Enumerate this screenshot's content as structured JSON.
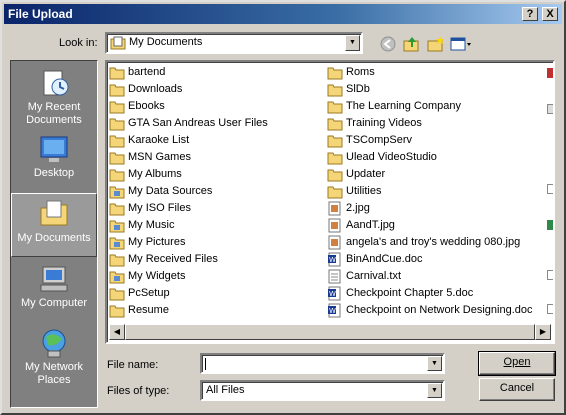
{
  "window": {
    "title": "File Upload",
    "help_button": "?",
    "close_button": "X"
  },
  "look_in": {
    "label": "Look in:",
    "value": "My Documents"
  },
  "places": [
    {
      "label": "My Recent Documents",
      "icon": "recent-documents-icon"
    },
    {
      "label": "Desktop",
      "icon": "desktop-icon"
    },
    {
      "label": "My Documents",
      "icon": "my-documents-icon",
      "selected": true
    },
    {
      "label": "My Computer",
      "icon": "my-computer-icon"
    },
    {
      "label": "My Network Places",
      "icon": "network-places-icon"
    }
  ],
  "files": {
    "column1": [
      {
        "name": "bartend",
        "type": "folder"
      },
      {
        "name": "Downloads",
        "type": "folder"
      },
      {
        "name": "Ebooks",
        "type": "folder"
      },
      {
        "name": "GTA San Andreas User Files",
        "type": "folder"
      },
      {
        "name": "Karaoke List",
        "type": "folder"
      },
      {
        "name": "MSN Games",
        "type": "folder"
      },
      {
        "name": "My Albums",
        "type": "folder"
      },
      {
        "name": "My Data Sources",
        "type": "special-folder"
      },
      {
        "name": "My ISO Files",
        "type": "folder"
      },
      {
        "name": "My Music",
        "type": "special-folder"
      },
      {
        "name": "My Pictures",
        "type": "special-folder"
      },
      {
        "name": "My Received Files",
        "type": "folder"
      },
      {
        "name": "My Widgets",
        "type": "special-folder"
      },
      {
        "name": "PcSetup",
        "type": "folder"
      },
      {
        "name": "Resume",
        "type": "folder"
      }
    ],
    "column2": [
      {
        "name": "Roms",
        "type": "folder"
      },
      {
        "name": "SlDb",
        "type": "folder"
      },
      {
        "name": "The Learning Company",
        "type": "folder"
      },
      {
        "name": "Training Videos",
        "type": "folder"
      },
      {
        "name": "TSCompServ",
        "type": "folder"
      },
      {
        "name": "Ulead VideoStudio",
        "type": "folder"
      },
      {
        "name": "Updater",
        "type": "folder"
      },
      {
        "name": "Utilities",
        "type": "folder"
      },
      {
        "name": "2.jpg",
        "type": "image"
      },
      {
        "name": "AandT.jpg",
        "type": "image"
      },
      {
        "name": "angela's and troy's wedding 080.jpg",
        "type": "image"
      },
      {
        "name": "BinAndCue.doc",
        "type": "doc"
      },
      {
        "name": "Carnival.txt",
        "type": "txt"
      },
      {
        "name": "Checkpoint Chapter 5.doc",
        "type": "doc"
      },
      {
        "name": "Checkpoint on Network Designing.doc",
        "type": "doc"
      }
    ]
  },
  "file_name": {
    "label": "File name:",
    "value": ""
  },
  "files_of_type": {
    "label": "Files of type:",
    "value": "All Files"
  },
  "buttons": {
    "open": "Open",
    "cancel": "Cancel"
  },
  "colors": {
    "title_start": "#0a246a",
    "title_end": "#a6caf0",
    "face": "#d4d0c8",
    "folder": "#f4d678"
  }
}
